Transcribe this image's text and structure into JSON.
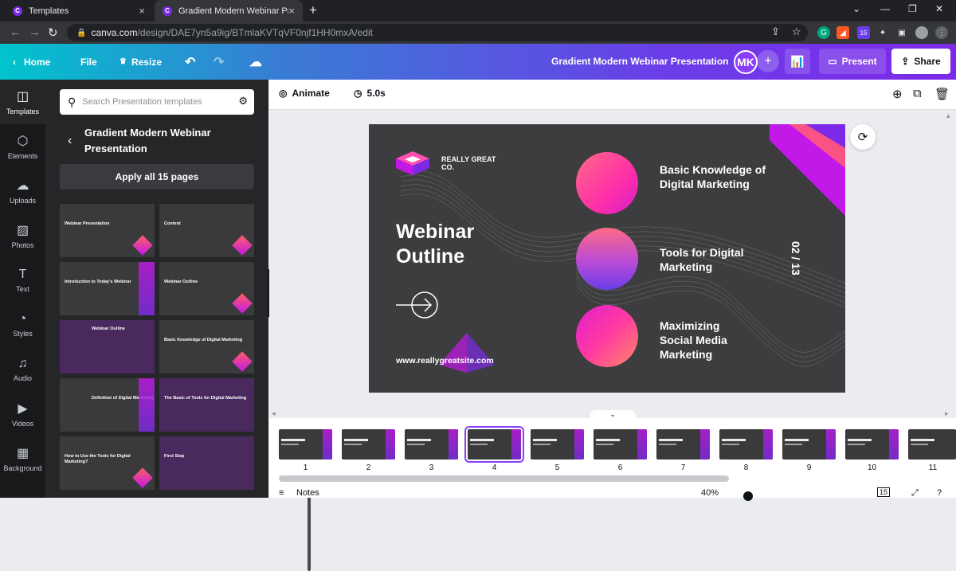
{
  "browser": {
    "tabs": [
      {
        "title": "Templates",
        "active": false
      },
      {
        "title": "Gradient Modern Webinar Presen",
        "active": true
      }
    ],
    "url_domain": "canva.com",
    "url_path": "/design/DAE7yn5a9ig/BTmlaKVTqVF0njf1HH0mxA/edit",
    "extension_badge": "15"
  },
  "header": {
    "home": "Home",
    "file": "File",
    "resize": "Resize",
    "doc_title": "Gradient Modern Webinar Presentation",
    "avatar_initials": "MK",
    "present": "Present",
    "share": "Share",
    "gradient_colors": [
      "#00c4cc",
      "#7d2ae8"
    ]
  },
  "rail": [
    {
      "label": "Templates",
      "icon": "templates-icon"
    },
    {
      "label": "Elements",
      "icon": "elements-icon"
    },
    {
      "label": "Uploads",
      "icon": "upload-icon"
    },
    {
      "label": "Photos",
      "icon": "photos-icon"
    },
    {
      "label": "Text",
      "icon": "text-icon"
    },
    {
      "label": "Styles",
      "icon": "palette-icon"
    },
    {
      "label": "Audio",
      "icon": "music-icon"
    },
    {
      "label": "Videos",
      "icon": "video-icon"
    },
    {
      "label": "Background",
      "icon": "background-icon"
    }
  ],
  "panel": {
    "search_placeholder": "Search Presentation templates",
    "template_title": "Gradient Modern Webinar Presentation",
    "apply_label": "Apply all 15 pages",
    "thumbs": [
      {
        "title": "Webinar Presentation"
      },
      {
        "title": "Content"
      },
      {
        "title": "Introduction to Today's Webinar"
      },
      {
        "title": "Webinar Outline"
      },
      {
        "title": "Webinar Outline"
      },
      {
        "title": "Basic Knowledge of Digital Marketing"
      },
      {
        "title": "Definition of Digital Marketing"
      },
      {
        "title": "The Basic of Tools for Digital Marketing"
      },
      {
        "title": "How to Use the Tools for Digital Marketing?"
      },
      {
        "title": "First Step"
      }
    ]
  },
  "toolbar": {
    "animate": "Animate",
    "duration": "5.0s"
  },
  "slide": {
    "company": "REALLY GREAT CO.",
    "title_line1": "Webinar",
    "title_line2": "Outline",
    "website": "www.reallygreatsite.com",
    "items": [
      "Basic Knowledge of Digital Marketing",
      "Tools for Digital Marketing",
      "Maximizing Social Media Marketing"
    ],
    "page_indicator": "02 / 13",
    "accent_colors": [
      "#ff6a88",
      "#c218e8",
      "#6b3de8"
    ]
  },
  "pages": {
    "numbers": [
      "1",
      "2",
      "3",
      "4",
      "5",
      "6",
      "7",
      "8",
      "9",
      "10",
      "11"
    ],
    "selected": 4
  },
  "bottom": {
    "notes": "Notes",
    "zoom": "40%",
    "page_count": "15"
  }
}
